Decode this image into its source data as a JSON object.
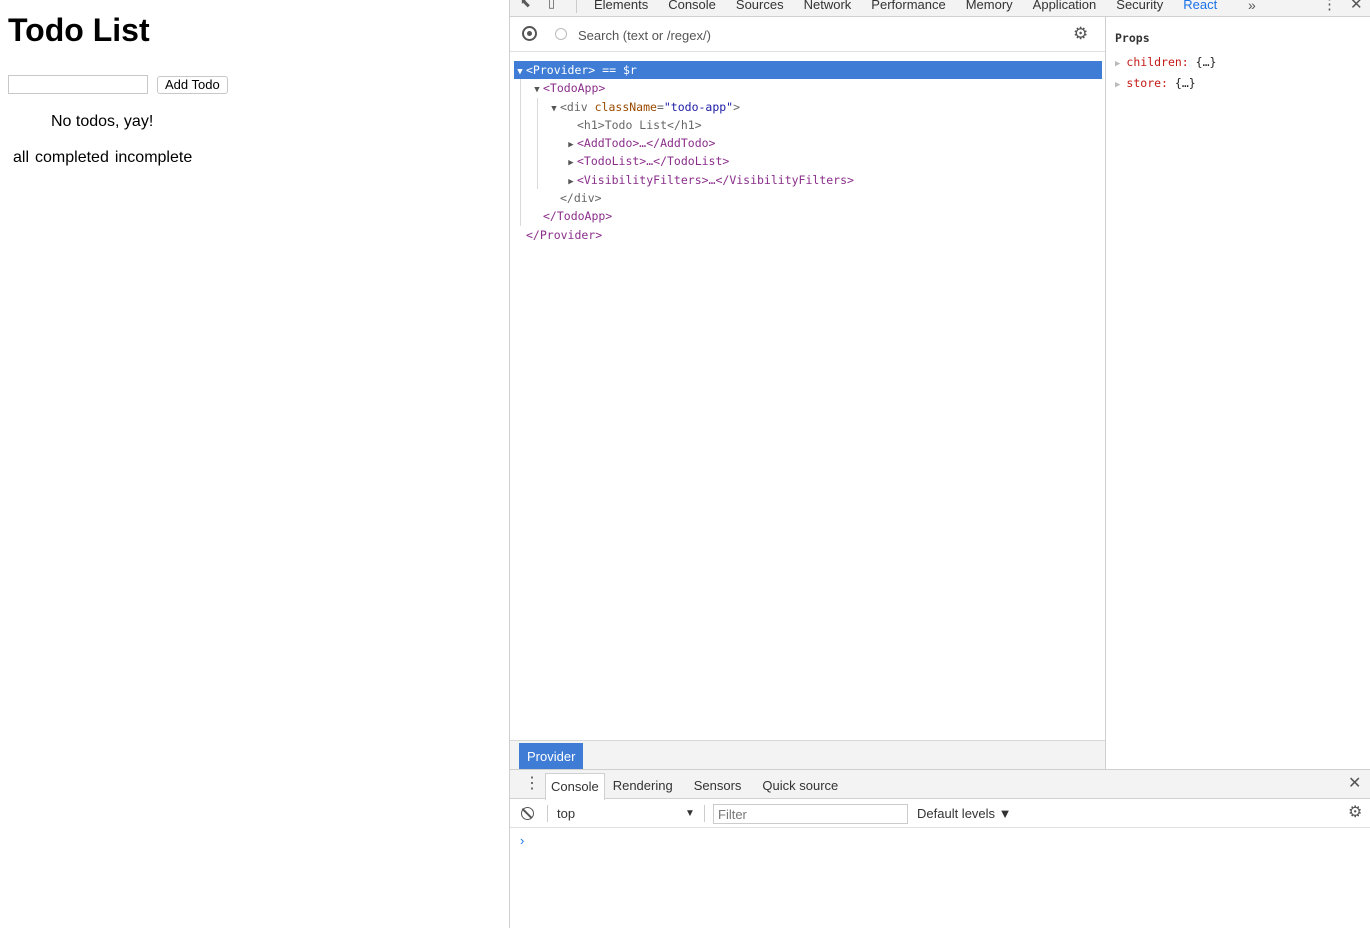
{
  "app": {
    "title": "Todo List",
    "input_value": "",
    "add_button": "Add Todo",
    "empty_message": "No todos, yay!",
    "filters": [
      "all",
      "completed",
      "incomplete"
    ]
  },
  "devtools": {
    "tabs": [
      "Elements",
      "Console",
      "Sources",
      "Network",
      "Performance",
      "Memory",
      "Application",
      "Security",
      "React"
    ],
    "active_tab": "React",
    "more_tabs": "»",
    "search_placeholder": "Search (text or /regex/)",
    "tree": [
      {
        "depth": 0,
        "arrow": "▼",
        "selected": true,
        "open": "<Provider>",
        "suffix": " == $r"
      },
      {
        "depth": 1,
        "arrow": "▼",
        "open": "<TodoApp>"
      },
      {
        "depth": 2,
        "arrow": "▼",
        "tag_open": "<div ",
        "attr": "className",
        "value": "\"todo-app\"",
        "tag_close": ">"
      },
      {
        "depth": 3,
        "arrow": "",
        "plain": "<h1>Todo List</h1>"
      },
      {
        "depth": 3,
        "arrow": "▶",
        "open": "<AddTodo>…</AddTodo>"
      },
      {
        "depth": 3,
        "arrow": "▶",
        "open": "<TodoList>…</TodoList>"
      },
      {
        "depth": 3,
        "arrow": "▶",
        "open": "<VisibilityFilters>…</VisibilityFilters>"
      },
      {
        "depth": 2,
        "arrow": "",
        "plain": "</div>"
      },
      {
        "depth": 1,
        "arrow": "",
        "open": "</TodoApp>"
      },
      {
        "depth": 0,
        "arrow": "",
        "open": "</Provider>"
      }
    ],
    "breadcrumb": "Provider",
    "props": {
      "title": "Props",
      "items": [
        {
          "key": "children:",
          "value": "{…}"
        },
        {
          "key": "store:",
          "value": "{…}"
        }
      ]
    },
    "drawer": {
      "tabs": [
        "Console",
        "Rendering",
        "Sensors",
        "Quick source"
      ],
      "active_tab": "Console",
      "context": "top",
      "filter_placeholder": "Filter",
      "levels": "Default levels ▼",
      "prompt": "›"
    }
  }
}
